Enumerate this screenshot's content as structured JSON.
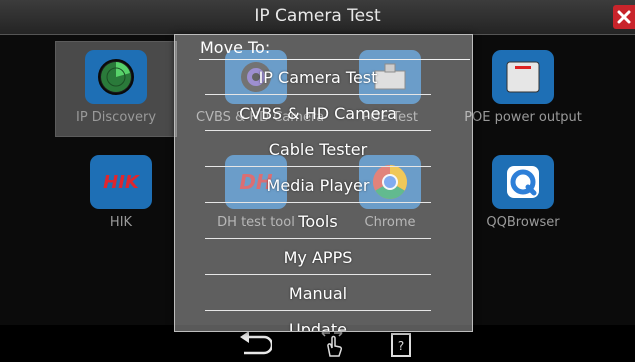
{
  "window": {
    "title": "IP Camera Test"
  },
  "apps": [
    {
      "label": "IP Discovery",
      "icon": "radar-icon"
    },
    {
      "label": "CVBS & HD Camera",
      "icon": "camera-icon"
    },
    {
      "label": "POE Test",
      "icon": "poe-test-icon"
    },
    {
      "label": "POE power output",
      "icon": "poe-power-icon"
    },
    {
      "label": "HIK",
      "icon": "hik-logo-icon",
      "logo_text": "HIK"
    },
    {
      "label": "DH test tool",
      "icon": "dh-logo-icon",
      "logo_text": "DH"
    },
    {
      "label": "Chrome",
      "icon": "chrome-icon"
    },
    {
      "label": "QQBrowser",
      "icon": "qqbrowser-icon"
    }
  ],
  "dialog": {
    "title": "Move To:",
    "items": [
      {
        "label": "IP Camera Test"
      },
      {
        "label": "CVBS & HD Camera"
      },
      {
        "label": "Cable Tester"
      },
      {
        "label": "Media Player"
      },
      {
        "label": "Tools"
      },
      {
        "label": "My APPS"
      },
      {
        "label": "Manual"
      },
      {
        "label": "Update"
      }
    ]
  },
  "navbar": {
    "icons": [
      "back-icon",
      "gesture-icon",
      "help-book-icon"
    ]
  },
  "colors": {
    "close": "#c8242b",
    "icon_blue": "#1e6fb5",
    "hik_red": "#e0262d"
  }
}
